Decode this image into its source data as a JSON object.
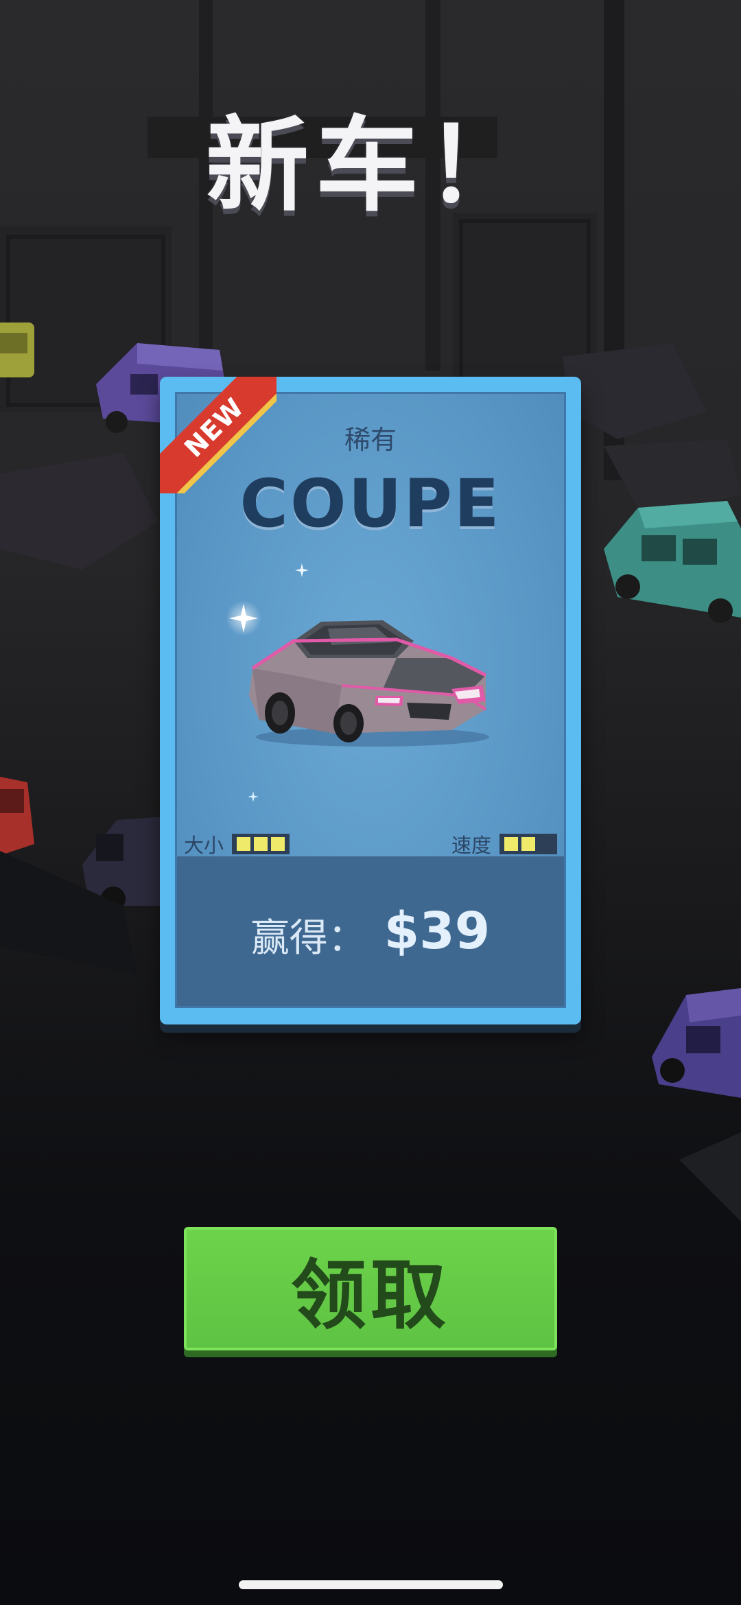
{
  "header": {
    "title": "新车！"
  },
  "card": {
    "badge": "NEW",
    "rarity": "稀有",
    "car_name": "COUPE",
    "stats": {
      "size_label": "大小",
      "size_level": 3,
      "size_max": 3,
      "speed_label": "速度",
      "speed_level": 2,
      "speed_max": 3
    },
    "reward_label": "赢得：",
    "reward_value": "$39"
  },
  "actions": {
    "claim_label": "领取"
  },
  "colors": {
    "card_border": "#5bbcf2",
    "ribbon": "#d83a2e",
    "claim_button": "#62c745",
    "stat_fill": "#f0ea6a",
    "car_body": "#9a8a94",
    "car_accent": "#e05aa8"
  }
}
